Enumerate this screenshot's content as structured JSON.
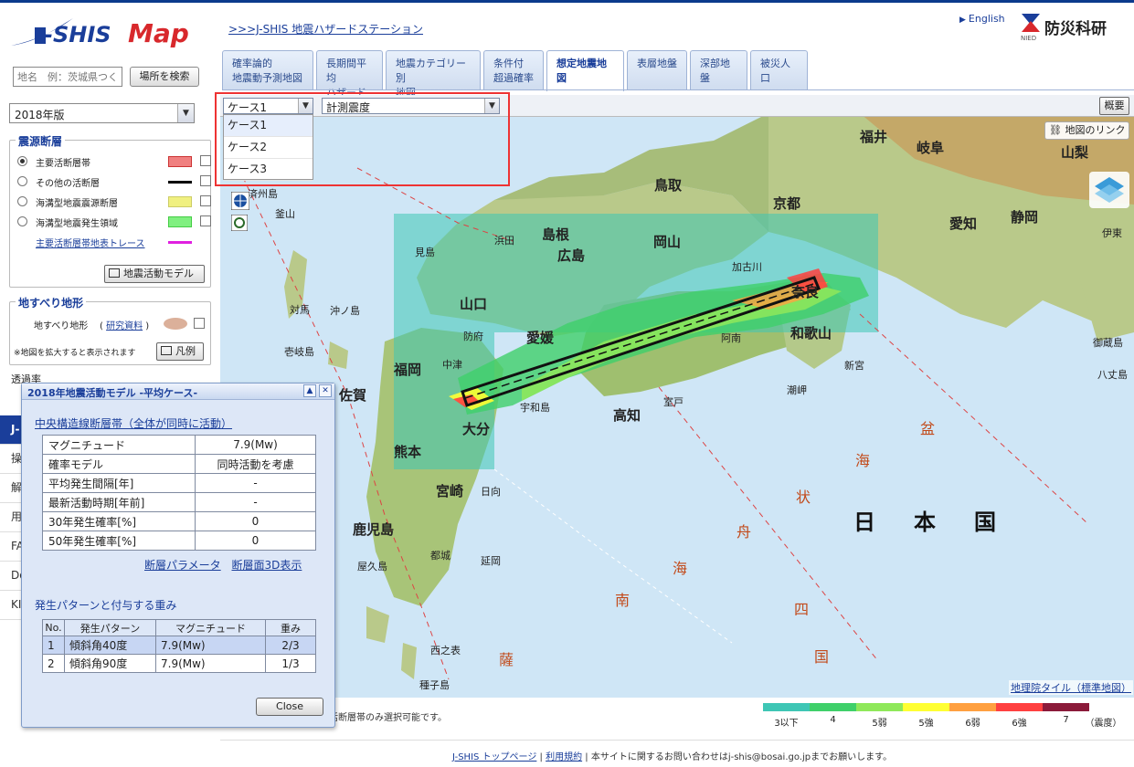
{
  "header": {
    "logo_text": "J-SHIS Map",
    "hazard_link": ">>>J-SHIS 地震ハザードステーション",
    "english": "English",
    "org_name": "防災科研",
    "org_abbr": "NIED"
  },
  "tabs": [
    {
      "label": "確率論的\n地震動予測地図",
      "active": false
    },
    {
      "label": "長期間平均\nハザード",
      "active": false
    },
    {
      "label": "地震カテゴリー別\n地図",
      "active": false
    },
    {
      "label": "条件付\n超過確率",
      "active": false
    },
    {
      "label": "想定地震地図",
      "active": true
    },
    {
      "label": "表層地盤",
      "active": false
    },
    {
      "label": "深部地盤",
      "active": false
    },
    {
      "label": "被災人口",
      "active": false
    }
  ],
  "sidebar": {
    "search_placeholder": "地名　例：茨城県つくば市",
    "search_button": "場所を検索",
    "year_select": "2018年版",
    "source_fault": {
      "title": "震源断層",
      "items": [
        {
          "label": "主要活断層帯",
          "color": "#f08080",
          "selected": true
        },
        {
          "label": "その他の活断層",
          "color": "#000000",
          "selected": false
        },
        {
          "label": "海溝型地震震源断層",
          "color": "#f0f080",
          "selected": false
        },
        {
          "label": "海溝型地震発生領域",
          "color": "#80f080",
          "selected": false
        }
      ],
      "trace_link": "主要活断層帯地表トレース",
      "trace_color": "#e020e0",
      "model_button": "地震活動モデル"
    },
    "landslide": {
      "title": "地すべり地形",
      "label": "地すべり地形",
      "research_link": "研究資料",
      "note": "※地図を拡大すると表示されます",
      "legend_button": "凡例"
    },
    "transparency_label": "透過率",
    "menu": [
      "J-",
      "操",
      "解",
      "用",
      "FA",
      "Do",
      "KI"
    ]
  },
  "map_toolbar": {
    "case_select": "ケース1",
    "case_options": [
      "ケース1",
      "ケース2",
      "ケース3"
    ],
    "measure_select": "計測震度",
    "summary_button": "概要",
    "map_link_button": "地図のリンク"
  },
  "map_labels": {
    "prefectures": [
      "福井",
      "岐阜",
      "山梨",
      "鳥取",
      "京都",
      "島根",
      "広島",
      "岡山",
      "愛知",
      "静岡",
      "山口",
      "奈良",
      "和歌山",
      "福岡",
      "佐賀",
      "宮崎",
      "鹿児島",
      "熊本",
      "大分",
      "愛媛",
      "高知"
    ],
    "places": [
      "浜田",
      "見島",
      "対馬",
      "壱岐島",
      "防府",
      "中津",
      "宇和島",
      "室戸",
      "新宮",
      "潮岬",
      "加古川",
      "阿南",
      "延岡",
      "日向",
      "都城",
      "西之表",
      "種子島",
      "屋久島",
      "沖ノ島",
      "釜山",
      "済州島",
      "伊東",
      "御蔵島",
      "八丈島"
    ],
    "sea_chars": [
      "南",
      "海",
      "舟",
      "状",
      "海",
      "盆",
      "四",
      "国",
      "薩"
    ],
    "country": "日本国",
    "gsi_link": "地理院タイル（標準地図）"
  },
  "legend": {
    "colors": [
      "#3ec6b5",
      "#3fd06a",
      "#8fe85a",
      "#ffff33",
      "#ffa040",
      "#ff4040",
      "#8b1a3a"
    ],
    "labels": [
      "3以下",
      "4",
      "5弱",
      "5強",
      "6弱",
      "6強",
      "7"
    ],
    "unit": "（震度）"
  },
  "note": "活断層帯のみ選択可能です。",
  "footer": {
    "top_link": "J-SHIS トップページ",
    "terms_link": "利用規約",
    "text": "本サイトに関するお問い合わせはj-shis@bosai.go.jpまでお願いします。"
  },
  "popup": {
    "title": "2018年地震活動モデル -平均ケース-",
    "fault_link": "中央構造線断層帯（全体が同時に活動）",
    "rows": [
      {
        "label": "マグニチュード",
        "value": "7.9(Mw)"
      },
      {
        "label": "確率モデル",
        "value": "同時活動を考慮"
      },
      {
        "label": "平均発生間隔[年]",
        "value": "-"
      },
      {
        "label": "最新活動時期[年前]",
        "value": "-"
      },
      {
        "label": "30年発生確率[%]",
        "value": "0"
      },
      {
        "label": "50年発生確率[%]",
        "value": "0"
      }
    ],
    "param_link": "断層パラメータ",
    "view3d_link": "断層面3D表示",
    "pattern_heading": "発生パターンと付与する重み",
    "pattern_headers": [
      "No.",
      "発生パターン",
      "マグニチュード",
      "重み"
    ],
    "patterns": [
      {
        "no": "1",
        "pattern": "傾斜角40度",
        "mag": "7.9(Mw)",
        "weight": "2/3",
        "highlight": true
      },
      {
        "no": "2",
        "pattern": "傾斜角90度",
        "mag": "7.9(Mw)",
        "weight": "1/3",
        "highlight": false
      }
    ],
    "close_button": "Close"
  }
}
